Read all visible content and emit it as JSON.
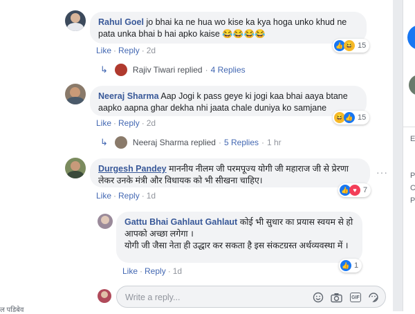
{
  "comments": [
    {
      "author": "Rahul Goel",
      "text": "jo bhai ka ne hua wo kise ka kya hoga unko khud ne pata unka bhai b hai apko kaise",
      "emojis": "😂😂😂😂",
      "actions": {
        "like": "Like",
        "reply": "Reply",
        "time": "2d"
      },
      "reaction_count": "15",
      "reactions": [
        "like",
        "haha"
      ],
      "reply_summary": {
        "name": "Rajiv Tiwari replied",
        "count": "4 Replies"
      }
    },
    {
      "author": "Neeraj Sharma",
      "text": "Aap Jogi k pass geye ki jogi kaa bhai aaya btane aapko aapna ghar dekha nhi jaata chale duniya ko samjane",
      "actions": {
        "like": "Like",
        "reply": "Reply",
        "time": "2d"
      },
      "reaction_count": "15",
      "reactions": [
        "haha",
        "like"
      ],
      "reply_summary": {
        "name": "Neeraj Sharma replied",
        "count": "5 Replies",
        "time": "1 hr"
      }
    },
    {
      "author": "Durgesh Pandey",
      "text": "माननीय नीलम जी परमपूज्य योगी जी महाराज जी से प्रेरणा लेकर उनके मंत्री और विधायक को भी सीखना चाहिए।",
      "actions": {
        "like": "Like",
        "reply": "Reply",
        "time": "1d"
      },
      "reaction_count": "7",
      "reactions": [
        "like",
        "love"
      ],
      "more": "···"
    }
  ],
  "reply": {
    "author": "Gattu Bhai Gahlaut Gahlaut",
    "text1": "कोई भी सुधार का प्रयास स्वयम से हो आपको अच्छा लगेगा ।",
    "text2": "योगी जी जैसा नेता ही उद्धार कर सकता है इस संकटग्रस्त अर्थव्यवस्था में ।",
    "actions": {
      "like": "Like",
      "reply": "Reply",
      "time": "1d"
    },
    "reaction_count": "1"
  },
  "composer": {
    "placeholder": "Write a reply..."
  },
  "icons": {
    "emoji": "smile-icon",
    "camera": "camera-icon",
    "gif": "GIF",
    "sticker": "sticker-icon"
  },
  "bottom_left_text": "ल पडिबेव",
  "right_panel": {
    "e": "E",
    "p": "P",
    "c": "C",
    "pr": "P"
  },
  "colors": {
    "link": "#385898",
    "action": "#4267b2",
    "bubble": "#f2f3f5",
    "like": "#1877f2"
  }
}
